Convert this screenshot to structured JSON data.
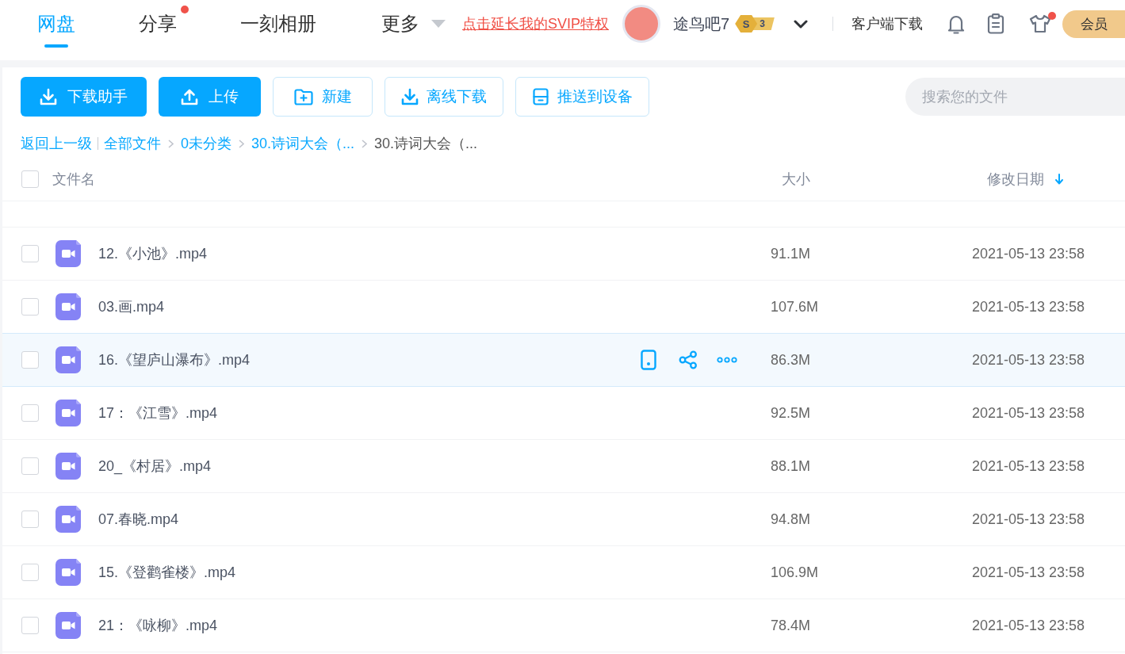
{
  "top_nav": {
    "tabs": [
      {
        "label": "网盘",
        "selected": true,
        "dot": false
      },
      {
        "label": "分享",
        "selected": false,
        "dot": true
      },
      {
        "label": "一刻相册",
        "selected": false,
        "dot": false
      }
    ],
    "more": {
      "label": "更多"
    },
    "promo_link": "点击延长我的SVIP特权",
    "user": {
      "name": "途鸟吧7",
      "badge_letter": "S",
      "badge_level": "3"
    },
    "client_download": "客户端下载",
    "icons": [
      {
        "kind": "bell",
        "dot": false
      },
      {
        "kind": "clipboard",
        "dot": false
      },
      {
        "kind": "shirt",
        "dot": true
      }
    ],
    "member_button": "会员"
  },
  "toolbar": {
    "buttons": [
      {
        "label": "下载助手",
        "kind": "primary"
      },
      {
        "label": "上传",
        "kind": "primary"
      },
      {
        "label": "新建",
        "kind": "outline"
      },
      {
        "label": "离线下载",
        "kind": "outline"
      },
      {
        "label": "推送到设备",
        "kind": "outline"
      }
    ],
    "search": {
      "placeholder": "搜索您的文件"
    }
  },
  "breadcrumb": {
    "back": "返回上一级",
    "items": [
      {
        "label": "全部文件",
        "current": false
      },
      {
        "label": "0未分类",
        "current": false
      },
      {
        "label": "30.诗词大会（...",
        "current": false
      },
      {
        "label": "30.诗词大会（...",
        "current": true
      }
    ]
  },
  "table": {
    "select_all_checked": false,
    "columns": [
      {
        "label": "文件名",
        "sorted": false
      },
      {
        "label": "大小",
        "sorted": false
      },
      {
        "label": "修改日期",
        "sorted": true
      }
    ],
    "rows": [
      {
        "name": "12.《小池》.mp4",
        "size": "91.1M",
        "modified": "2021-05-13 23:58",
        "checked": false,
        "hovered": false
      },
      {
        "name": "03.画.mp4",
        "size": "107.6M",
        "modified": "2021-05-13 23:58",
        "checked": false,
        "hovered": false
      },
      {
        "name": "16.《望庐山瀑布》.mp4",
        "size": "86.3M",
        "modified": "2021-05-13 23:58",
        "checked": false,
        "hovered": true
      },
      {
        "name": "17：《江雪》.mp4",
        "size": "92.5M",
        "modified": "2021-05-13 23:58",
        "checked": false,
        "hovered": false
      },
      {
        "name": "20_《村居》.mp4",
        "size": "88.1M",
        "modified": "2021-05-13 23:58",
        "checked": false,
        "hovered": false
      },
      {
        "name": "07.春晓.mp4",
        "size": "94.8M",
        "modified": "2021-05-13 23:58",
        "checked": false,
        "hovered": false
      },
      {
        "name": "15.《登鹳雀楼》.mp4",
        "size": "106.9M",
        "modified": "2021-05-13 23:58",
        "checked": false,
        "hovered": false
      },
      {
        "name": "21：《咏柳》.mp4",
        "size": "78.4M",
        "modified": "2021-05-13 23:58",
        "checked": false,
        "hovered": false
      }
    ]
  }
}
